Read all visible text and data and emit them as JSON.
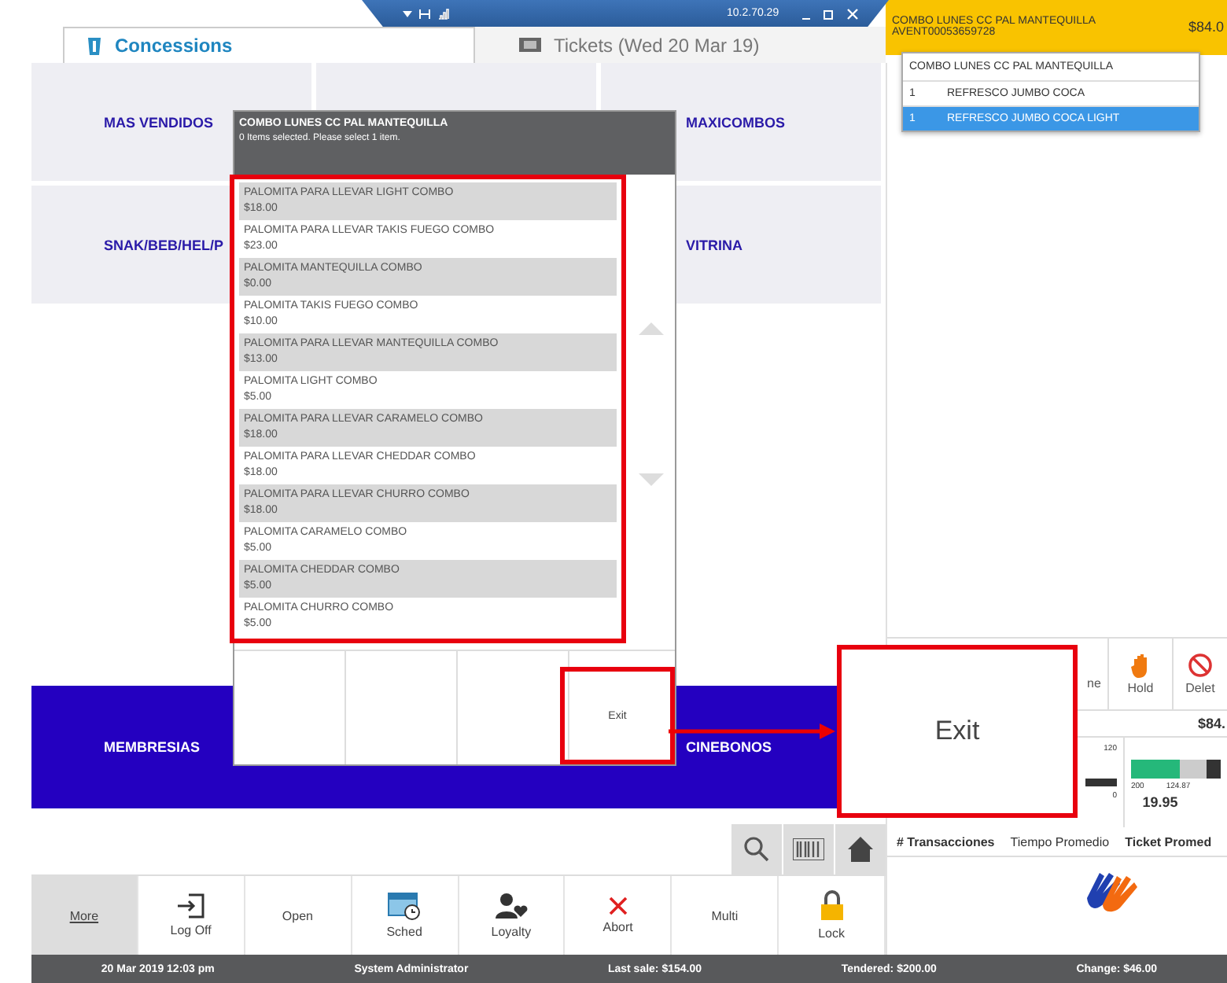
{
  "remote_bar": {
    "address": "10.2.70.29"
  },
  "tabs": [
    {
      "label": "Concessions",
      "selected": true
    },
    {
      "label": "Tickets (Wed 20 Mar 19)",
      "selected": false
    }
  ],
  "order_header": {
    "title": "COMBO LUNES CC PAL MANTEQUILLA",
    "code": "AVENT00053659728",
    "amount": "$84.0"
  },
  "order_dropdown": {
    "title": "COMBO LUNES CC PAL MANTEQUILLA",
    "items": [
      {
        "qty": "1",
        "name": "REFRESCO JUMBO COCA",
        "selected": false
      },
      {
        "qty": "1",
        "name": "REFRESCO JUMBO COCA LIGHT",
        "selected": true
      }
    ]
  },
  "category_rows": [
    {
      "kind": "gray",
      "left": "MAS VENDIDOS",
      "right": "MAXICOMBOS"
    },
    {
      "kind": "gray",
      "left": "SNAK/BEB/HEL/P",
      "right": "VITRINA"
    },
    {
      "kind": "blue",
      "left": "MEMBRESIAS",
      "right": "CINEBONOS"
    }
  ],
  "modal": {
    "title": "COMBO LUNES CC PAL MANTEQUILLA",
    "subtitle": "0 Items selected. Please select 1 item.",
    "options": [
      {
        "name": "PALOMITA PARA LLEVAR LIGHT COMBO",
        "price": "$18.00"
      },
      {
        "name": "PALOMITA PARA LLEVAR TAKIS FUEGO COMBO",
        "price": "$23.00"
      },
      {
        "name": "PALOMITA MANTEQUILLA COMBO",
        "price": "$0.00"
      },
      {
        "name": "PALOMITA TAKIS FUEGO COMBO",
        "price": "$10.00"
      },
      {
        "name": "PALOMITA PARA LLEVAR MANTEQUILLA COMBO",
        "price": "$13.00"
      },
      {
        "name": "PALOMITA LIGHT COMBO",
        "price": "$5.00"
      },
      {
        "name": "PALOMITA PARA LLEVAR CARAMELO COMBO",
        "price": "$18.00"
      },
      {
        "name": "PALOMITA PARA LLEVAR CHEDDAR COMBO",
        "price": "$18.00"
      },
      {
        "name": "PALOMITA PARA LLEVAR CHURRO COMBO",
        "price": "$18.00"
      },
      {
        "name": "PALOMITA CARAMELO COMBO",
        "price": "$5.00"
      },
      {
        "name": "PALOMITA CHEDDAR COMBO",
        "price": "$5.00"
      },
      {
        "name": "PALOMITA CHURRO COMBO",
        "price": "$5.00"
      }
    ],
    "exit_button": "Exit"
  },
  "callout": {
    "label": "Exit"
  },
  "actions": [
    {
      "label": "ne"
    },
    {
      "label": "Hold"
    },
    {
      "label": "Delet"
    }
  ],
  "total": "$84.",
  "gauges": [
    {
      "kind": "simple",
      "max_label": "120",
      "min_label": "0"
    },
    {
      "kind": "range",
      "min_label": "200",
      "mid_label": "124.87",
      "value": "19.95"
    }
  ],
  "stat_labels": [
    "# Transacciones",
    "Tiempo Promedio",
    "Ticket Promed"
  ],
  "toolbar": [
    {
      "label": "More",
      "selected": true
    },
    {
      "label": "Log Off",
      "selected": false
    },
    {
      "label": "Open",
      "selected": false
    },
    {
      "label": "Sched",
      "selected": false
    },
    {
      "label": "Loyalty",
      "selected": false
    },
    {
      "label": "Abort",
      "selected": false
    },
    {
      "label": "Multi",
      "selected": false
    },
    {
      "label": "Lock",
      "selected": false
    }
  ],
  "status_bar": [
    "20 Mar 2019 12:03 pm",
    "System Administrator",
    "Last sale: $154.00",
    "Tendered: $200.00",
    "Change: $46.00"
  ]
}
